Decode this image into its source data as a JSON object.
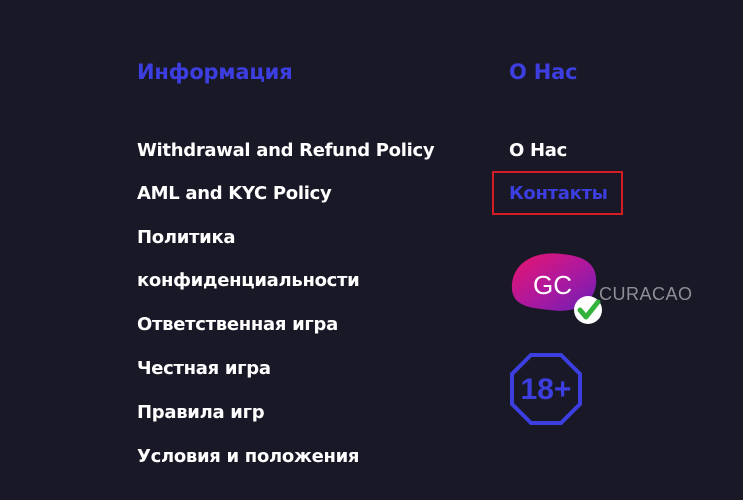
{
  "info": {
    "heading": "Информация",
    "links": [
      "Withdrawal and Refund Policy",
      "AML and KYC Policy",
      "Политика",
      "конфиденциальности",
      "Ответственная игра",
      "Честная игра",
      "Правила игр",
      "Условия и положения"
    ]
  },
  "about": {
    "heading": "О Нас",
    "links": [
      "О Нас",
      "Контакты"
    ],
    "active_link": "Контакты"
  },
  "license_logo": {
    "initials": "GC",
    "country": "CURACAO",
    "icon": "checkmark-icon"
  },
  "age_badge": {
    "text": "18+"
  },
  "colors": {
    "background": "#191826",
    "accent": "#3d3ee0",
    "text": "#ffffff",
    "highlight": "#d41c24"
  }
}
